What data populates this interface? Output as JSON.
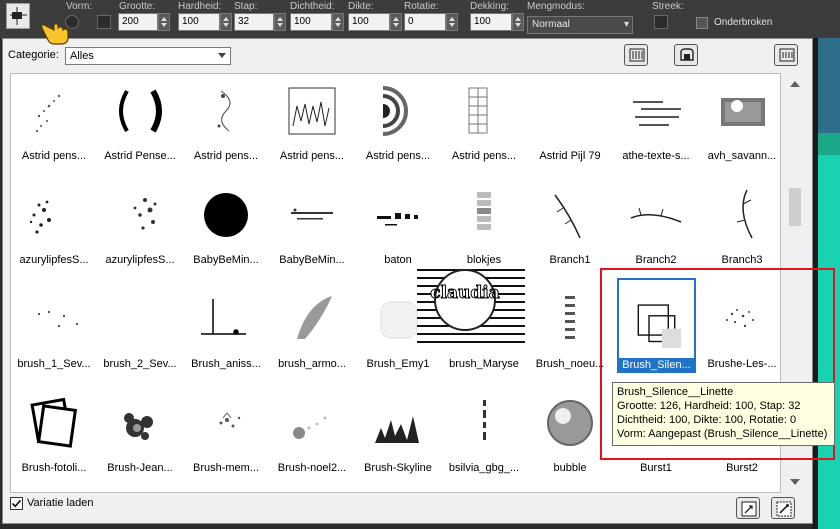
{
  "toolbar": {
    "labels": [
      "Vorm:",
      "Grootte:",
      "Hardheid:",
      "Stap:",
      "Dichtheid:",
      "Dikte:",
      "Rotatie:",
      "Dekking:",
      "Mengmodus:",
      "Streek:"
    ],
    "values": {
      "grootte": "200",
      "hardheid": "100",
      "stap": "32",
      "dichtheid": "100",
      "dikte": "100",
      "rotatie": "0",
      "dekking": "100"
    },
    "mengmodus": "Normaal",
    "onderbroken": "Onderbroken"
  },
  "popup": {
    "category_label": "Categorie:",
    "category_value": "Alles",
    "variatie_label": "Variatie laden",
    "variatie_checked": true
  },
  "brushes": [
    {
      "label": "Astrid pens..."
    },
    {
      "label": "Astrid Pense..."
    },
    {
      "label": "Astrid pens..."
    },
    {
      "label": "Astrid pens..."
    },
    {
      "label": "Astrid pens..."
    },
    {
      "label": "Astrid pens..."
    },
    {
      "label": "Astrid Pijl 79"
    },
    {
      "label": "athe-texte-s..."
    },
    {
      "label": "avh_savann..."
    },
    {
      "label": "azurylipfesS..."
    },
    {
      "label": "azurylipfesS..."
    },
    {
      "label": "BabyBeMin..."
    },
    {
      "label": "BabyBeMin..."
    },
    {
      "label": "baton"
    },
    {
      "label": "blokjes"
    },
    {
      "label": "Branch1"
    },
    {
      "label": "Branch2"
    },
    {
      "label": "Branch3"
    },
    {
      "label": "brush_1_Sev..."
    },
    {
      "label": "brush_2_Sev..."
    },
    {
      "label": "Brush_aniss..."
    },
    {
      "label": "brush_armo..."
    },
    {
      "label": "Brush_Emy1"
    },
    {
      "label": "brush_Maryse"
    },
    {
      "label": "Brush_noeu..."
    },
    {
      "label": "Brush_Silen..."
    },
    {
      "label": "Brushe-Les-..."
    },
    {
      "label": "Brush-fotoli..."
    },
    {
      "label": "Brush-Jean..."
    },
    {
      "label": "Brush-mem..."
    },
    {
      "label": "Brush-noel2..."
    },
    {
      "label": "Brush-Skyline"
    },
    {
      "label": "bsilvia_gbg_..."
    },
    {
      "label": "bubble"
    },
    {
      "label": "Burst1"
    },
    {
      "label": "Burst2"
    }
  ],
  "tooltip": {
    "line1": "Brush_Silence__Linette",
    "line2": "Grootte: 126, Hardheid: 100, Stap: 32",
    "line3": "Dichtheid: 100, Dikte: 100, Rotatie: 0",
    "line4": "Vorm: Aangepast (Brush_Silence__Linette)"
  },
  "watermark": "claudia",
  "colors": {
    "selection": "#1f73c9",
    "highlight_box": "#e0141e",
    "tooltip_bg": "#ffffe1"
  }
}
